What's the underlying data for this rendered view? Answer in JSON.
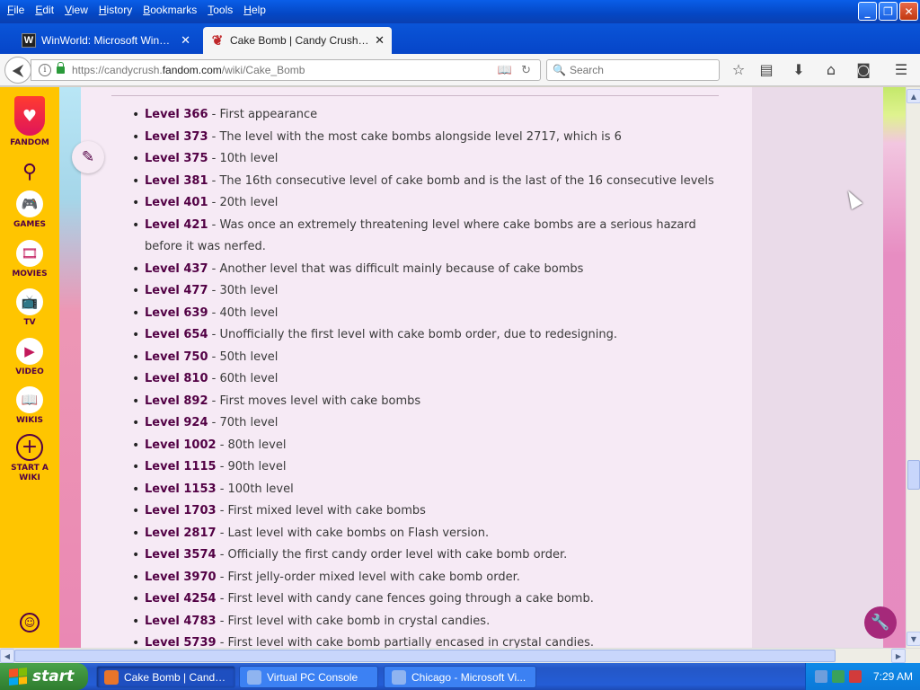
{
  "menubar": {
    "items": [
      {
        "label": "File",
        "ul": "F",
        "rest": "ile"
      },
      {
        "label": "Edit",
        "ul": "E",
        "rest": "dit"
      },
      {
        "label": "View",
        "ul": "V",
        "rest": "iew"
      },
      {
        "label": "History",
        "ul": "H",
        "rest": "istory"
      },
      {
        "label": "Bookmarks",
        "ul": "B",
        "rest": "ookmarks"
      },
      {
        "label": "Tools",
        "ul": "T",
        "rest": "ools"
      },
      {
        "label": "Help",
        "ul": "H",
        "rest": "elp"
      }
    ]
  },
  "window_buttons": {
    "minimize": "_",
    "maximize": "❐",
    "close": "✕"
  },
  "tabs": [
    {
      "favicon": "W",
      "title": "WinWorld: Microsoft Windows...",
      "close": "✕"
    },
    {
      "favicon": "❦",
      "title": "Cake Bomb | Candy Crush Sa...",
      "close": "✕"
    }
  ],
  "new_tab": "+",
  "navbar": {
    "back": "⮜",
    "info": "i",
    "url_prefix": "https://candycrush.",
    "url_host": "fandom.com",
    "url_path": "/wiki/Cake_Bomb",
    "reader_icon": "📖",
    "reload_icon": "↻",
    "search_placeholder": "Search",
    "search_icon": "🔍",
    "icons": {
      "bookmark_star": "☆",
      "bookmarks_list": "▤",
      "download": "⬇",
      "home": "⌂",
      "pocket": "◙",
      "menu": "☰"
    }
  },
  "fandom_sidebar": {
    "logo_label": "FANDOM",
    "search_icon": "⚲",
    "items": [
      {
        "label": "GAMES",
        "icon": "🎮"
      },
      {
        "label": "MOVIES",
        "icon": "🎞"
      },
      {
        "label": "TV",
        "icon": "📺"
      },
      {
        "label": "VIDEO",
        "icon": "▶"
      },
      {
        "label": "WIKIS",
        "icon": "📖"
      }
    ],
    "start_wiki_label": "START A\nWIKI",
    "start_wiki_icon": "+",
    "user_icon": "☺"
  },
  "edit_icon": "✎",
  "tools_icon": "🔧",
  "levels": [
    {
      "level": "Level 366",
      "desc": " - First appearance"
    },
    {
      "level": "Level 373",
      "desc": " - The level with the most cake bombs alongside level 2717, which is 6"
    },
    {
      "level": "Level 375",
      "desc": " - 10th level"
    },
    {
      "level": "Level 381",
      "desc": " - The 16th consecutive level of cake bomb and is the last of the 16 consecutive levels"
    },
    {
      "level": "Level 401",
      "desc": " - 20th level"
    },
    {
      "level": "Level 421",
      "desc": " - Was once an extremely threatening level where cake bombs are a serious hazard before it was nerfed."
    },
    {
      "level": "Level 437",
      "desc": " - Another level that was difficult mainly because of cake bombs"
    },
    {
      "level": "Level 477",
      "desc": " - 30th level"
    },
    {
      "level": "Level 639",
      "desc": " - 40th level"
    },
    {
      "level": "Level 654",
      "desc": " - Unofficially the first level with cake bomb order, due to redesigning."
    },
    {
      "level": "Level 750",
      "desc": " - 50th level"
    },
    {
      "level": "Level 810",
      "desc": " - 60th level"
    },
    {
      "level": "Level 892",
      "desc": " - First moves level with cake bombs"
    },
    {
      "level": "Level 924",
      "desc": " - 70th level"
    },
    {
      "level": "Level 1002",
      "desc": " - 80th level"
    },
    {
      "level": "Level 1115",
      "desc": " - 90th level"
    },
    {
      "level": "Level 1153",
      "desc": " - 100th level"
    },
    {
      "level": "Level 1703",
      "desc": " - First mixed level with cake bombs"
    },
    {
      "level": "Level 2817",
      "desc": " - Last level with cake bombs on Flash version."
    },
    {
      "level": "Level 3574",
      "desc": " - Officially the first candy order level with cake bomb order."
    },
    {
      "level": "Level 3970",
      "desc": " - First jelly-order mixed level with cake bomb order."
    },
    {
      "level": "Level 4254",
      "desc": " - First level with candy cane fences going through a cake bomb."
    },
    {
      "level": "Level 4783",
      "desc": " - First level with cake bomb in crystal candies."
    },
    {
      "level": "Level 5739",
      "desc": " - First level with cake bomb partially encased in crystal candies."
    }
  ],
  "scrollbar": {
    "up": "▲",
    "down": "▼",
    "left": "◀",
    "right": "▶"
  },
  "taskbar": {
    "start_label": "start",
    "tasks": [
      {
        "title": "Cake Bomb | Candy C...",
        "icon_color": "#e8752a",
        "active": true
      },
      {
        "title": "Virtual PC Console",
        "icon_color": "#8fb4f0",
        "active": false
      },
      {
        "title": "Chicago - Microsoft Vi...",
        "icon_color": "#8fb4f0",
        "active": false
      }
    ],
    "clock": "7:29 AM"
  },
  "colors": {
    "fandom_yellow": "#ffc500",
    "fandom_purple": "#520044",
    "link_color": "#520044",
    "content_bg": "#f6eaf5"
  }
}
